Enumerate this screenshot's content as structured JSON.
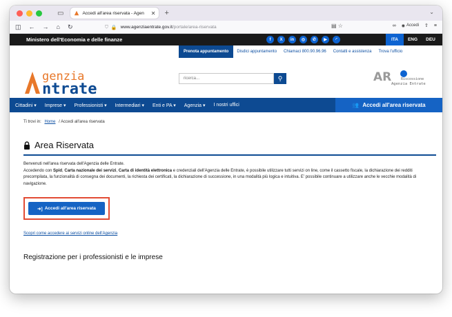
{
  "browser": {
    "tab_title": "Accedi all'area riservata - Agen",
    "tab_close": "✕",
    "new_tab": "+",
    "url_host": "www.agenziaentrate.gov.it",
    "url_path": "/portale/area-riservata",
    "account_label": "Accedi",
    "icons": [
      "back-icon",
      "forward-icon",
      "home-icon",
      "reload-icon",
      "shield-icon",
      "lock-icon",
      "reader-icon",
      "star-icon",
      "extensions-icon",
      "account-icon",
      "share-icon",
      "menu-icon"
    ]
  },
  "ministry_bar": {
    "title": "Ministero dell'Economia e delle finanze",
    "languages": [
      "ITA",
      "ENG",
      "DEU"
    ],
    "active_language": "ITA",
    "socials": [
      "f",
      "X",
      "in",
      "ig",
      "wa",
      "yt",
      "rss"
    ]
  },
  "header": {
    "links": [
      "Prenota appuntamento",
      "Disdici appuntamento",
      "Chiamaci 800.90.96.96",
      "Contatti e assistenza",
      "Trova l'ufficio"
    ],
    "logo_line1": "genzia",
    "logo_line2": "ntrate",
    "search_placeholder": "ricerca...",
    "ar_logo_line1": "Riscossione",
    "ar_logo_line2": "Agenzia Entrate"
  },
  "menu": {
    "items": [
      "Cittadini ▾",
      "Imprese ▾",
      "Professionisti ▾",
      "Intermediari ▾",
      "Enti e PA ▾",
      "Agenzia ▾",
      "I nostri uffici"
    ],
    "cta": "Accedi all'area riservata"
  },
  "breadcrumb": {
    "prefix": "Ti trovi in:",
    "home": "Home",
    "current": "/ Accedi all'area riservata"
  },
  "main": {
    "title": "Area Riservata",
    "p1": "Benvenuti nell'area riservata dell'Agenzia delle Entrate.",
    "p2_a": "Accedendo con ",
    "p2_b1": "Spid",
    "p2_c1": ", ",
    "p2_b2": "Carta nazionale dei servizi",
    "p2_c2": ", ",
    "p2_b3": "Carta di identità elettronica",
    "p2_d": " e credenziali dell'Agenzia delle Entrate, è possibile utilizzare tutti servizi on line, come il cassetto fiscale, la dichiarazione dei redditi precompilata, la funzionalità di consegna dei documenti, la richiesta dei certificati, la dichiarazione di successione, in una modalità più logica e intuitiva. E' possibile continuare a utilizzare anche le vecchie modalità di navigazione.",
    "cta_label": "Accedi all'area riservata",
    "discover_link": "Scopri come accedere ai servizi online dell'Agenzia",
    "section_title": "Registrazione per i professionisti e le imprese"
  },
  "colors": {
    "brand_blue": "#0d4a92",
    "cta_blue": "#1563c4",
    "highlight_red": "#e24a33",
    "logo_orange": "#e8782a"
  }
}
